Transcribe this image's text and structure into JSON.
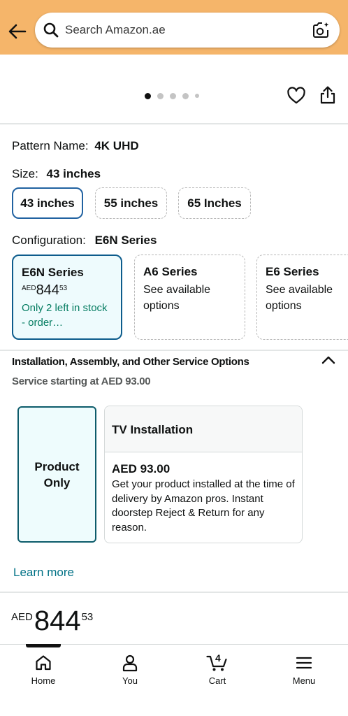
{
  "header": {
    "search_placeholder": "Search Amazon.ae"
  },
  "carousel": {
    "dot_count": 5,
    "active_index": 0
  },
  "pattern": {
    "label": "Pattern Name:",
    "value": "4K UHD"
  },
  "size": {
    "label": "Size:",
    "value": "43 inches",
    "options": [
      "43 inches",
      "55 inches",
      "65 Inches"
    ]
  },
  "configuration": {
    "label": "Configuration:",
    "value": "E6N Series",
    "options": [
      {
        "title": "E6N Series",
        "currency": "AED",
        "price_whole": "844",
        "price_fraction": "53",
        "stock": "Only 2 left in stock - order…"
      },
      {
        "title": "A6 Series",
        "subtitle": "See available options"
      },
      {
        "title": "E6 Series",
        "subtitle": "See available options"
      }
    ]
  },
  "services": {
    "title": "Installation, Assembly, and Other Service Options",
    "subtitle": "Service starting at AED 93.00",
    "product_only_label": "Product Only",
    "tv_installation": {
      "title": "TV Installation",
      "price": "AED 93.00",
      "description": "Get your product installed at the time of delivery by Amazon pros. Instant doorstep Reject & Return for any reason."
    },
    "learn_more": "Learn more"
  },
  "price": {
    "currency": "AED",
    "whole": "844",
    "fraction": "53"
  },
  "bottom_nav": {
    "home": "Home",
    "you": "You",
    "cart": "Cart",
    "cart_count": "4",
    "menu": "Menu"
  },
  "colors": {
    "header": "#f5b56a",
    "link": "#007185",
    "stock": "#067d62",
    "selected_border": "#2162a1"
  }
}
